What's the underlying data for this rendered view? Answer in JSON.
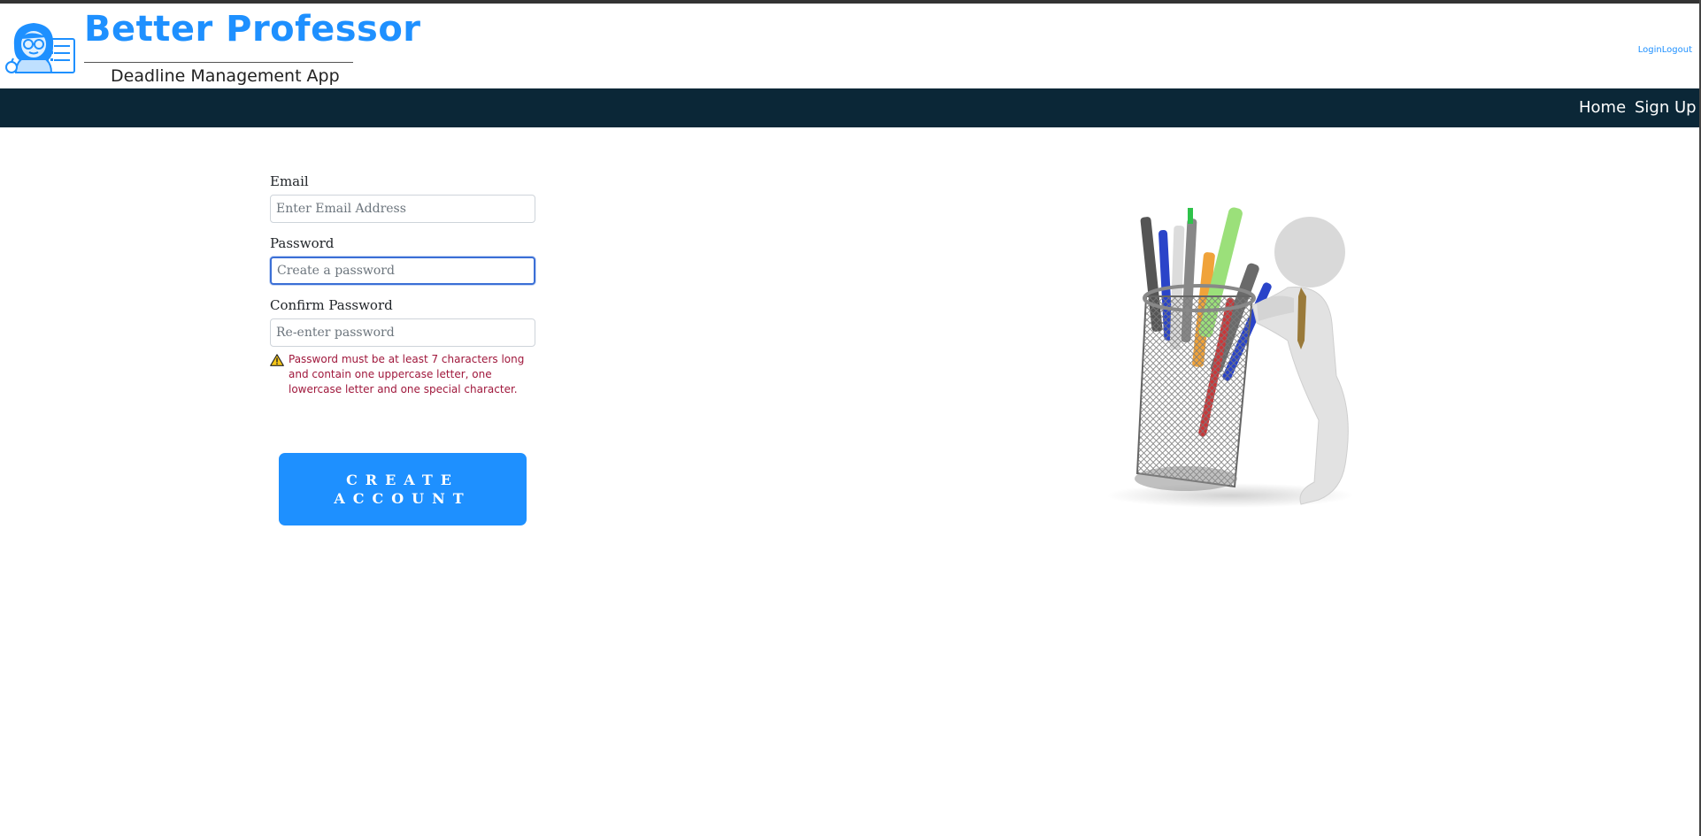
{
  "header": {
    "brand_title": "Better Professor",
    "brand_subtitle": "Deadline Management App",
    "login_label": "Login",
    "logout_label": "Logout"
  },
  "nav": {
    "items": [
      {
        "label": "Home"
      },
      {
        "label": "Sign Up"
      }
    ]
  },
  "form": {
    "email": {
      "label": "Email",
      "placeholder": "Enter Email Address",
      "value": ""
    },
    "password": {
      "label": "Password",
      "placeholder": "Create a password",
      "value": ""
    },
    "confirm_password": {
      "label": "Confirm Password",
      "placeholder": "Re-enter password",
      "value": ""
    },
    "warning": "Password must be at least 7 characters long and contain one uppercase letter, one lowercase letter and one special character.",
    "submit_label": "CREATE ACCOUNT"
  },
  "colors": {
    "brand_blue": "#1e90ff",
    "navbar_bg": "#0b2737",
    "warning_text": "#a0183c"
  },
  "icons": {
    "logo": "professor-logo-icon",
    "warning": "warning-triangle-icon",
    "illustration": "pen-holder-figure-illustration"
  }
}
